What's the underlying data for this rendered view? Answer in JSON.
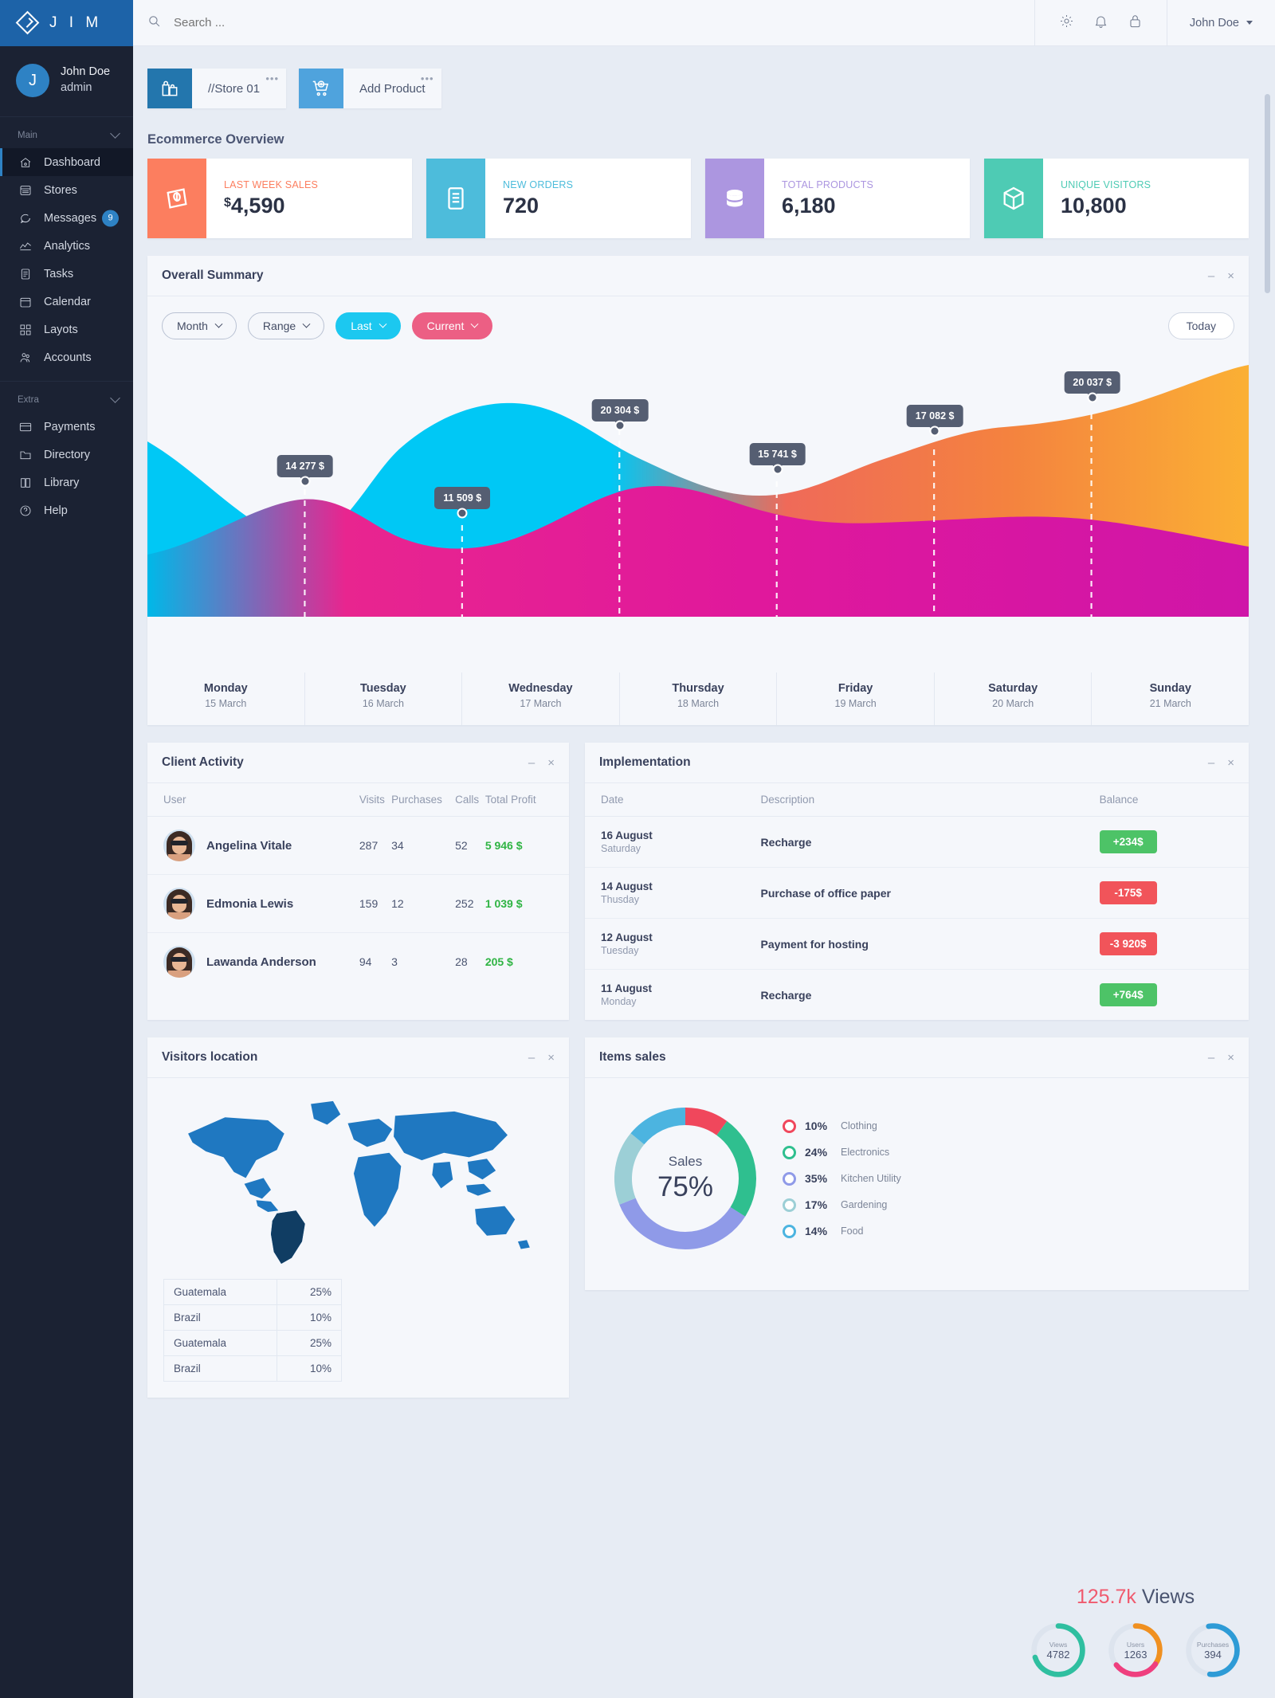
{
  "brand": {
    "logo_icon": "diamond-chevron-icon",
    "name": "J I M"
  },
  "topbar": {
    "search": {
      "icon": "search-icon",
      "placeholder": "Search ...",
      "value": ""
    },
    "icons": [
      "gear-icon",
      "bell-icon",
      "lock-icon"
    ],
    "user": {
      "name": "John Doe",
      "caret": "chevron-down-icon"
    }
  },
  "sidebar": {
    "profile": {
      "initial": "J",
      "name": "John Doe",
      "role": "admin"
    },
    "sections": [
      {
        "label": "Main",
        "collapse_icon": "chevron-down-icon",
        "items": [
          {
            "label": "Dashboard",
            "icon": "home-icon",
            "active": true,
            "badge": ""
          },
          {
            "label": "Stores",
            "icon": "store-icon",
            "active": false,
            "badge": ""
          },
          {
            "label": "Messages",
            "icon": "chat-bubble-icon",
            "active": false,
            "badge": "9"
          },
          {
            "label": "Analytics",
            "icon": "analytics-icon",
            "active": false,
            "badge": ""
          },
          {
            "label": "Tasks",
            "icon": "tasks-icon",
            "active": false,
            "badge": ""
          },
          {
            "label": "Calendar",
            "icon": "calendar-icon",
            "active": false,
            "badge": ""
          },
          {
            "label": "Layots",
            "icon": "grid-icon",
            "active": false,
            "badge": ""
          },
          {
            "label": "Accounts",
            "icon": "users-icon",
            "active": false,
            "badge": ""
          }
        ]
      },
      {
        "label": "Extra",
        "collapse_icon": "chevron-down-icon",
        "items": [
          {
            "label": "Payments",
            "icon": "card-icon",
            "active": false,
            "badge": ""
          },
          {
            "label": "Directory",
            "icon": "folder-icon",
            "active": false,
            "badge": ""
          },
          {
            "label": "Library",
            "icon": "book-icon",
            "active": false,
            "badge": ""
          },
          {
            "label": "Help",
            "icon": "help-circle-icon",
            "active": false,
            "badge": ""
          }
        ]
      }
    ]
  },
  "shortcuts": [
    {
      "label": "//Store 01",
      "icon": "shopping-bags-icon",
      "color": "#2376ad",
      "menu": "•••"
    },
    {
      "label": "Add Product",
      "icon": "add-to-cart-icon",
      "color": "#4fa3dd",
      "menu": "•••"
    }
  ],
  "overview": {
    "title": "Ecommerce Overview",
    "stats": [
      {
        "label": "LAST WEEK SALES",
        "value": "4,590",
        "currency": "$",
        "icon": "banknote-icon",
        "color": "#fc7e5f"
      },
      {
        "label": "NEW ORDERS",
        "value": "720",
        "currency": "",
        "icon": "document-icon",
        "color": "#4dbcdb"
      },
      {
        "label": "TOTAL PRODUCTS",
        "value": "6,180",
        "currency": "",
        "icon": "database-icon",
        "color": "#ac96e0"
      },
      {
        "label": "UNIQUE VISITORS",
        "value": "10,800",
        "currency": "",
        "icon": "cube-icon",
        "color": "#4ecbb4"
      }
    ]
  },
  "summary_panel": {
    "title": "Overall Summary",
    "minimize": "–",
    "close": "×",
    "filters": [
      {
        "label": "Month",
        "style": "ghost",
        "caret": "chevron-down-icon"
      },
      {
        "label": "Range",
        "style": "ghost",
        "caret": "chevron-down-icon"
      },
      {
        "label": "Last",
        "style": "cyan",
        "caret": "chevron-down-icon"
      },
      {
        "label": "Current",
        "style": "pink",
        "caret": "chevron-down-icon"
      }
    ],
    "today_button": "Today"
  },
  "chart_data": {
    "type": "area",
    "title": "Overall Summary",
    "xlabel": "",
    "ylabel": "",
    "grid": false,
    "legend": "none",
    "categories": [
      "Monday",
      "Tuesday",
      "Wednesday",
      "Thursday",
      "Friday",
      "Saturday",
      "Sunday"
    ],
    "tick_sublabels": [
      "15 March",
      "16 March",
      "17 March",
      "18 March",
      "19 March",
      "20 March",
      "21 March"
    ],
    "point_labels": [
      "14 277 $",
      "11 509 $",
      "20 304 $",
      "15 741 $",
      "17 082 $",
      "20 037 $"
    ],
    "series": [
      {
        "name": "Current",
        "values": [
          14277,
          11509,
          20304,
          15741,
          17082,
          20037,
          21500
        ]
      },
      {
        "name": "Last",
        "values": [
          16500,
          9500,
          24000,
          18000,
          14500,
          12500,
          11000
        ]
      }
    ],
    "colors": {
      "series_a_start": "#00c8f5",
      "series_a_end": "#f9a03c",
      "series_b_start": "#e0218a",
      "series_b_end": "#c9189f"
    }
  },
  "client_activity": {
    "title": "Client Activity",
    "minimize": "–",
    "close": "×",
    "columns": [
      "User",
      "Visits",
      "Purchases",
      "Calls",
      "Total Profit"
    ],
    "rows": [
      {
        "user": "Angelina Vitale",
        "visits": "287",
        "purchases": "34",
        "calls": "52",
        "profit": "5 946 $"
      },
      {
        "user": "Edmonia Lewis",
        "visits": "159",
        "purchases": "12",
        "calls": "252",
        "profit": "1 039 $"
      },
      {
        "user": "Lawanda Anderson",
        "visits": "94",
        "purchases": "3",
        "calls": "28",
        "profit": "205 $"
      }
    ]
  },
  "implementation": {
    "title": "Implementation",
    "minimize": "–",
    "close": "×",
    "columns": [
      "Date",
      "Description",
      "Balance"
    ],
    "rows": [
      {
        "date": "16 August",
        "day": "Saturday",
        "description": "Recharge",
        "balance": "+234$",
        "sign": "pos"
      },
      {
        "date": "14 August",
        "day": "Thusday",
        "description": "Purchase of office paper",
        "balance": "-175$",
        "sign": "neg"
      },
      {
        "date": "12 August",
        "day": "Tuesday",
        "description": "Payment for hosting",
        "balance": "-3 920$",
        "sign": "neg"
      },
      {
        "date": "11 August",
        "day": "Monday",
        "description": "Recharge",
        "balance": "+764$",
        "sign": "pos"
      }
    ]
  },
  "visitors_location": {
    "title": "Visitors location",
    "minimize": "–",
    "close": "×",
    "map_icon": "world-map",
    "locations": [
      {
        "country": "Guatemala",
        "percent": "25%"
      },
      {
        "country": "Brazil",
        "percent": "10%"
      },
      {
        "country": "Guatemala",
        "percent": "25%"
      },
      {
        "country": "Brazil",
        "percent": "10%"
      }
    ],
    "views_total": "125.7k",
    "views_word": "Views",
    "gauges": [
      {
        "caption": "Views",
        "value": "4782",
        "color": "#2fbfa0",
        "percent": 70
      },
      {
        "caption": "Users",
        "value": "1263",
        "color": "#ef3f7e",
        "percent": 60
      },
      {
        "caption": "Purchases",
        "value": "394",
        "color": "#2e9bd6",
        "percent": 55
      }
    ]
  },
  "items_sales": {
    "title": "Items sales",
    "minimize": "–",
    "close": "×",
    "donut_caption": "Sales",
    "donut_value": "75%",
    "legend": [
      {
        "percent": "10%",
        "name": "Clothing",
        "color": "#f0475c"
      },
      {
        "percent": "24%",
        "name": "Electronics",
        "color": "#2fbf8f"
      },
      {
        "percent": "35%",
        "name": "Kitchen Utility",
        "color": "#7e86e8"
      },
      {
        "percent": "17%",
        "name": "Gardening",
        "color": "#4cb4e0"
      },
      {
        "percent": "14%",
        "name": "Food",
        "color": "#3aa9da"
      }
    ]
  }
}
